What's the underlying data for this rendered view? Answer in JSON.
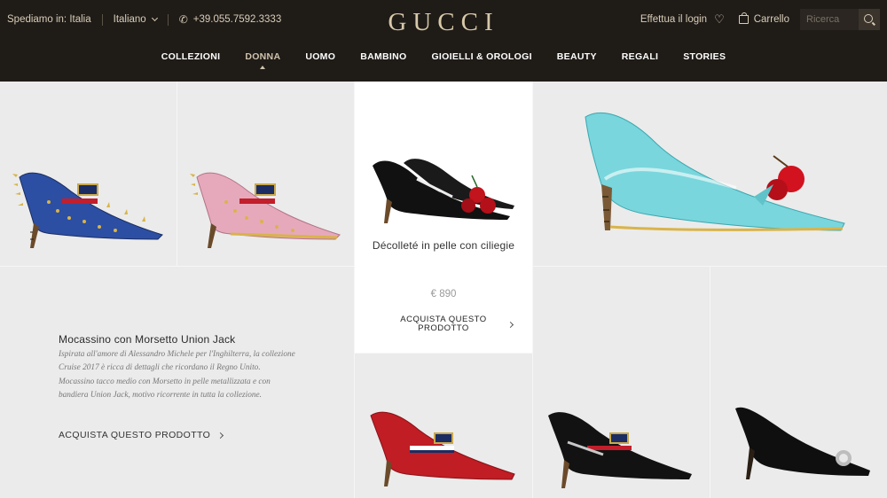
{
  "topbar": {
    "ship_to": "Spediamo in: Italia",
    "language": "Italiano",
    "phone": "+39.055.7592.3333",
    "login": "Effettua il login",
    "cart": "Carrello",
    "search_placeholder": "Ricerca"
  },
  "brand": {
    "logo": "GUCCI"
  },
  "nav": {
    "items": [
      "COLLEZIONI",
      "DONNA",
      "UOMO",
      "BAMBINO",
      "GIOIELLI & OROLOGI",
      "BEAUTY",
      "REGALI",
      "STORIES"
    ],
    "active": "DONNA"
  },
  "featured_product": {
    "title": "Décolleté in pelle con ciliegie",
    "price": "€ 890",
    "cta": "ACQUISTA QUESTO PRODOTTO"
  },
  "promo": {
    "title": "Mocassino con Morsetto Union Jack",
    "description": "Ispirata all'amore di Alessandro Michele per l'Inghilterra, la collezione Cruise 2017 è ricca di dettagli che ricordano il Regno Unito. Mocassino tacco medio con Morsetto in pelle metallizzata e con bandiera Union Jack, motivo ricorrente in tutta la collezione.",
    "cta": "ACQUISTA QUESTO PRODOTTO"
  },
  "colors": {
    "header_bg": "#1f1b17",
    "gold": "#d7c9a9",
    "tile_bg": "#ebebeb"
  }
}
